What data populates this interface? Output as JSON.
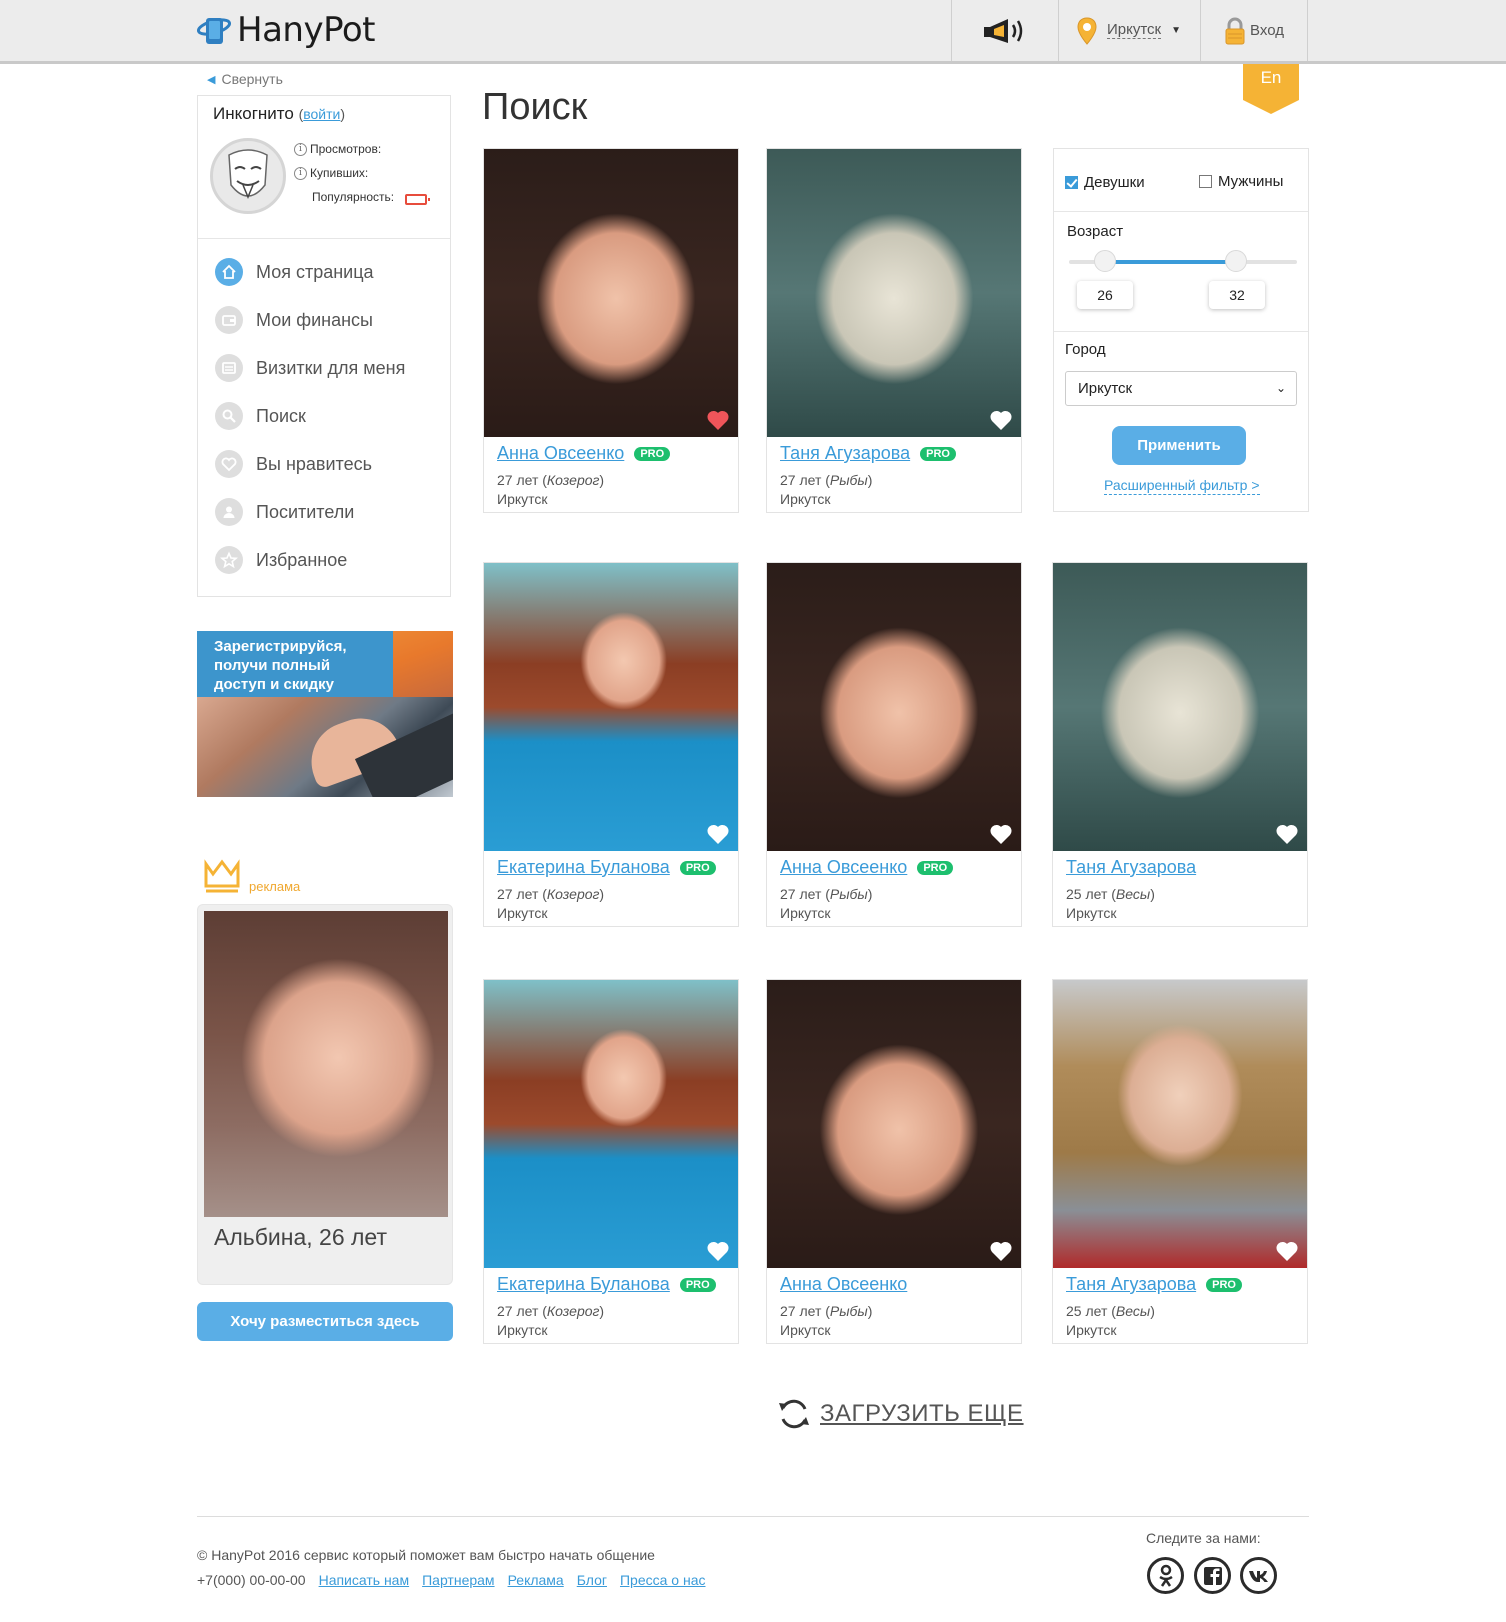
{
  "header": {
    "logo_text": "HanyPot",
    "city": "Иркутск",
    "login_label": "Вход",
    "lang": "En"
  },
  "sidebar": {
    "collapse_label": "Свернуть",
    "profile": {
      "name": "Инкогнито",
      "login_link": "войти",
      "views_label": "Просмотров:",
      "buyers_label": "Купивших:",
      "popularity_label": "Популярность:"
    },
    "menu": [
      {
        "label": "Моя страница",
        "icon": "home-icon",
        "active": true
      },
      {
        "label": "Мои финансы",
        "icon": "wallet-icon",
        "active": false
      },
      {
        "label": "Визитки для меня",
        "icon": "cards-icon",
        "active": false
      },
      {
        "label": "Поиск",
        "icon": "search-icon",
        "active": false
      },
      {
        "label": "Вы нравитесь",
        "icon": "heart-icon",
        "active": false
      },
      {
        "label": "Поситители",
        "icon": "user-icon",
        "active": false
      },
      {
        "label": "Избранное",
        "icon": "star-icon",
        "active": false
      }
    ],
    "promo_text": "Зарегистрируйся, получи полный доступ и скидку",
    "ad_label": "реклама",
    "ad_name": "Альбина, 26 лет",
    "ad_button": "Хочу разместиться здесь"
  },
  "main": {
    "title": "Поиск",
    "pro_badge": "PRO",
    "cards": [
      {
        "name": "Анна Овсеенко",
        "pro": true,
        "age": "27 лет",
        "sign": "Козерог",
        "city": "Иркутск",
        "liked": true
      },
      {
        "name": "Таня Агузарова",
        "pro": true,
        "age": "27 лет",
        "sign": "Рыбы",
        "city": "Иркутск",
        "liked": false
      },
      {
        "name": "Екатерина Буланова",
        "pro": true,
        "age": "27 лет",
        "sign": "Козерог",
        "city": "Иркутск",
        "liked": false
      },
      {
        "name": "Анна Овсеенко",
        "pro": true,
        "age": "27 лет",
        "sign": "Рыбы",
        "city": "Иркутск",
        "liked": false
      },
      {
        "name": "Таня Агузарова",
        "pro": false,
        "age": "25 лет",
        "sign": "Весы",
        "city": "Иркутск",
        "liked": false
      },
      {
        "name": "Екатерина Буланова",
        "pro": true,
        "age": "27 лет",
        "sign": "Козерог",
        "city": "Иркутск",
        "liked": false
      },
      {
        "name": "Анна Овсеенко",
        "pro": false,
        "age": "27 лет",
        "sign": "Рыбы",
        "city": "Иркутск",
        "liked": false
      },
      {
        "name": "Таня Агузарова",
        "pro": true,
        "age": "25 лет",
        "sign": "Весы",
        "city": "Иркутск",
        "liked": false
      }
    ],
    "load_more": "ЗАГРУЗИТЬ ЕЩЕ"
  },
  "filter": {
    "girls_label": "Девушки",
    "girls_checked": true,
    "men_label": "Мужчины",
    "men_checked": false,
    "age_label": "Возраст",
    "age_min": "26",
    "age_max": "32",
    "city_label": "Город",
    "city_value": "Иркутск",
    "apply_label": "Применить",
    "extended_link": "Расширенный фильтр >"
  },
  "footer": {
    "copyright": "© HanyPot 2016 сервис который поможет вам быстро начать общение",
    "phone": "+7(000) 00-00-00",
    "links": [
      "Написать нам",
      "Партнерам",
      "Реклама",
      "Блог",
      "Пресса о нас"
    ],
    "follow_label": "Следите за нами:",
    "social": [
      "odnoklassniki-icon",
      "facebook-icon",
      "vk-icon"
    ]
  },
  "colors": {
    "accent": "#5aaee6",
    "link": "#3a9bd9",
    "pro": "#1dbf6e",
    "lang_ribbon": "#f5b335",
    "ad_label": "#f0a830"
  }
}
